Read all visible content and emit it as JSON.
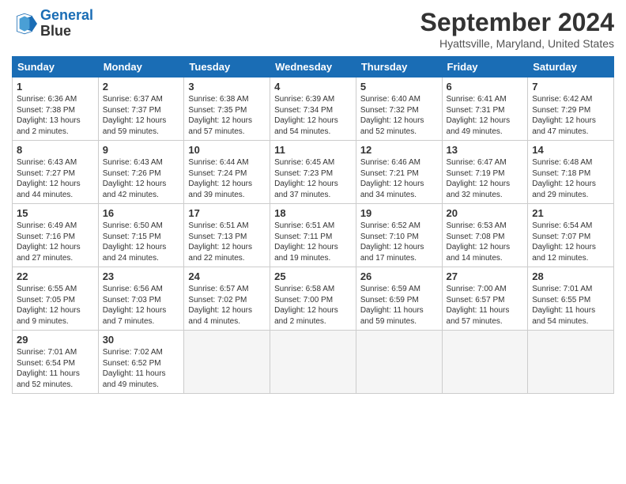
{
  "header": {
    "logo_line1": "General",
    "logo_line2": "Blue",
    "month": "September 2024",
    "location": "Hyattsville, Maryland, United States"
  },
  "weekdays": [
    "Sunday",
    "Monday",
    "Tuesday",
    "Wednesday",
    "Thursday",
    "Friday",
    "Saturday"
  ],
  "weeks": [
    [
      {
        "day": "1",
        "text": "Sunrise: 6:36 AM\nSunset: 7:38 PM\nDaylight: 13 hours\nand 2 minutes."
      },
      {
        "day": "2",
        "text": "Sunrise: 6:37 AM\nSunset: 7:37 PM\nDaylight: 12 hours\nand 59 minutes."
      },
      {
        "day": "3",
        "text": "Sunrise: 6:38 AM\nSunset: 7:35 PM\nDaylight: 12 hours\nand 57 minutes."
      },
      {
        "day": "4",
        "text": "Sunrise: 6:39 AM\nSunset: 7:34 PM\nDaylight: 12 hours\nand 54 minutes."
      },
      {
        "day": "5",
        "text": "Sunrise: 6:40 AM\nSunset: 7:32 PM\nDaylight: 12 hours\nand 52 minutes."
      },
      {
        "day": "6",
        "text": "Sunrise: 6:41 AM\nSunset: 7:31 PM\nDaylight: 12 hours\nand 49 minutes."
      },
      {
        "day": "7",
        "text": "Sunrise: 6:42 AM\nSunset: 7:29 PM\nDaylight: 12 hours\nand 47 minutes."
      }
    ],
    [
      {
        "day": "8",
        "text": "Sunrise: 6:43 AM\nSunset: 7:27 PM\nDaylight: 12 hours\nand 44 minutes."
      },
      {
        "day": "9",
        "text": "Sunrise: 6:43 AM\nSunset: 7:26 PM\nDaylight: 12 hours\nand 42 minutes."
      },
      {
        "day": "10",
        "text": "Sunrise: 6:44 AM\nSunset: 7:24 PM\nDaylight: 12 hours\nand 39 minutes."
      },
      {
        "day": "11",
        "text": "Sunrise: 6:45 AM\nSunset: 7:23 PM\nDaylight: 12 hours\nand 37 minutes."
      },
      {
        "day": "12",
        "text": "Sunrise: 6:46 AM\nSunset: 7:21 PM\nDaylight: 12 hours\nand 34 minutes."
      },
      {
        "day": "13",
        "text": "Sunrise: 6:47 AM\nSunset: 7:19 PM\nDaylight: 12 hours\nand 32 minutes."
      },
      {
        "day": "14",
        "text": "Sunrise: 6:48 AM\nSunset: 7:18 PM\nDaylight: 12 hours\nand 29 minutes."
      }
    ],
    [
      {
        "day": "15",
        "text": "Sunrise: 6:49 AM\nSunset: 7:16 PM\nDaylight: 12 hours\nand 27 minutes."
      },
      {
        "day": "16",
        "text": "Sunrise: 6:50 AM\nSunset: 7:15 PM\nDaylight: 12 hours\nand 24 minutes."
      },
      {
        "day": "17",
        "text": "Sunrise: 6:51 AM\nSunset: 7:13 PM\nDaylight: 12 hours\nand 22 minutes."
      },
      {
        "day": "18",
        "text": "Sunrise: 6:51 AM\nSunset: 7:11 PM\nDaylight: 12 hours\nand 19 minutes."
      },
      {
        "day": "19",
        "text": "Sunrise: 6:52 AM\nSunset: 7:10 PM\nDaylight: 12 hours\nand 17 minutes."
      },
      {
        "day": "20",
        "text": "Sunrise: 6:53 AM\nSunset: 7:08 PM\nDaylight: 12 hours\nand 14 minutes."
      },
      {
        "day": "21",
        "text": "Sunrise: 6:54 AM\nSunset: 7:07 PM\nDaylight: 12 hours\nand 12 minutes."
      }
    ],
    [
      {
        "day": "22",
        "text": "Sunrise: 6:55 AM\nSunset: 7:05 PM\nDaylight: 12 hours\nand 9 minutes."
      },
      {
        "day": "23",
        "text": "Sunrise: 6:56 AM\nSunset: 7:03 PM\nDaylight: 12 hours\nand 7 minutes."
      },
      {
        "day": "24",
        "text": "Sunrise: 6:57 AM\nSunset: 7:02 PM\nDaylight: 12 hours\nand 4 minutes."
      },
      {
        "day": "25",
        "text": "Sunrise: 6:58 AM\nSunset: 7:00 PM\nDaylight: 12 hours\nand 2 minutes."
      },
      {
        "day": "26",
        "text": "Sunrise: 6:59 AM\nSunset: 6:59 PM\nDaylight: 11 hours\nand 59 minutes."
      },
      {
        "day": "27",
        "text": "Sunrise: 7:00 AM\nSunset: 6:57 PM\nDaylight: 11 hours\nand 57 minutes."
      },
      {
        "day": "28",
        "text": "Sunrise: 7:01 AM\nSunset: 6:55 PM\nDaylight: 11 hours\nand 54 minutes."
      }
    ],
    [
      {
        "day": "29",
        "text": "Sunrise: 7:01 AM\nSunset: 6:54 PM\nDaylight: 11 hours\nand 52 minutes."
      },
      {
        "day": "30",
        "text": "Sunrise: 7:02 AM\nSunset: 6:52 PM\nDaylight: 11 hours\nand 49 minutes."
      },
      {
        "day": "",
        "text": ""
      },
      {
        "day": "",
        "text": ""
      },
      {
        "day": "",
        "text": ""
      },
      {
        "day": "",
        "text": ""
      },
      {
        "day": "",
        "text": ""
      }
    ]
  ]
}
